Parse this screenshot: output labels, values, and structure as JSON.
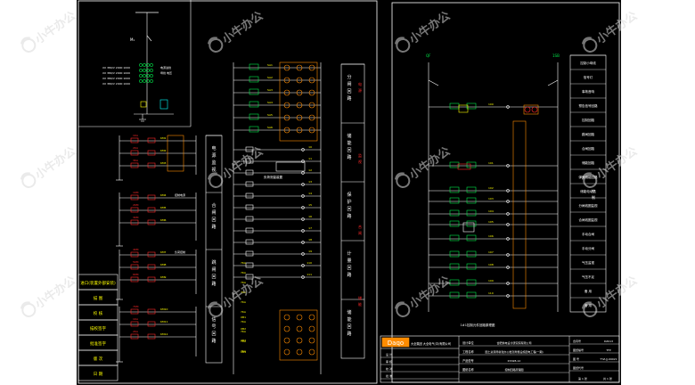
{
  "canvas": {
    "bg": "#ffffff",
    "drawing_bg": "#000000"
  },
  "colors": {
    "wire": "#ffffff",
    "red": "#ff2a2a",
    "yellow": "#ffff00",
    "green": "#00e84a",
    "cyan": "#00ffff",
    "orange": "#ff8c00",
    "watermark": "#d9d9d9"
  },
  "watermark": {
    "text": "小牛办公",
    "icon": "bull-logo-icon"
  },
  "left_panel": {
    "incoming_label": "M₁",
    "spec_lines": [
      "XX 380/V 2000 1000",
      "XX 380/V 2000 1000",
      "XX 380/V 2000 1000",
      "XX 380/V 2000 1000"
    ],
    "side_notes": [
      "电源进线",
      "母线 电压"
    ],
    "title_block_rows": [
      "进口(装置外部安装)",
      "描 图",
      "校 核",
      "描校签字",
      "批准签字",
      "版 次",
      "日 期"
    ],
    "relay_tags": [
      "1KA",
      "2KA",
      "3KA",
      "1KM",
      "2KM",
      "3KM",
      "4KM",
      "5KM",
      "6KM",
      "7KM"
    ],
    "note_a": "控制电源",
    "note_b": "负荷控制",
    "col1_labels": [
      "电 源 监 视",
      "合 闸 回 路",
      "跳 闸 回 路",
      "信 号 回 路"
    ],
    "col2_labels": [
      "分 闸 回 路",
      "储 能 回 路",
      "保 护 回 路",
      "计 量 回 路",
      "储 能 回 路"
    ],
    "col3_labels": [
      "电 源",
      "监 视",
      "合 闸",
      "储 能"
    ],
    "device_note": "负荷测量装置"
  },
  "right_panel": {
    "top_tags": [
      "QF",
      "1SB"
    ],
    "legend_items": [
      "控制小母线",
      "信号灯",
      "事故音响",
      "预告信号回路",
      "控制回路",
      "跳闸回路",
      "合闸回路",
      "储能回路",
      "弹簧储能回路",
      "储能电动机",
      "分闸线圈监视",
      "合闸线圈监视",
      "手动合闸",
      "手动分闸",
      "气压监视",
      "气压不足",
      "备 用",
      "备 用"
    ],
    "side_label": "控 制",
    "bottom_caption": "1#1控制元件回路原理图"
  },
  "title_block": {
    "logo": "Daqo",
    "company": "大全集团 大全电气(中)有限公司",
    "fields": [
      "设计单位",
      "工程名称",
      "产品型号",
      "图纸名称"
    ],
    "values": [
      "合肥供电设计研究院有限公司",
      "国土资源局新建办公楼及附属设施配电工程(一期)",
      "KYN28-12",
      "控制回路原理图"
    ],
    "right_fields": [
      "合同号",
      "图纸编号",
      "图 号",
      "图纸代号"
    ],
    "right_values": [
      "DZ013",
      "TFP",
      "TYZ-JJ-99021"
    ],
    "sign_labels": [
      "设 计",
      "审 核",
      "校 对",
      "批 准"
    ],
    "sheet": "第 1 张",
    "total": "共 1 张"
  }
}
